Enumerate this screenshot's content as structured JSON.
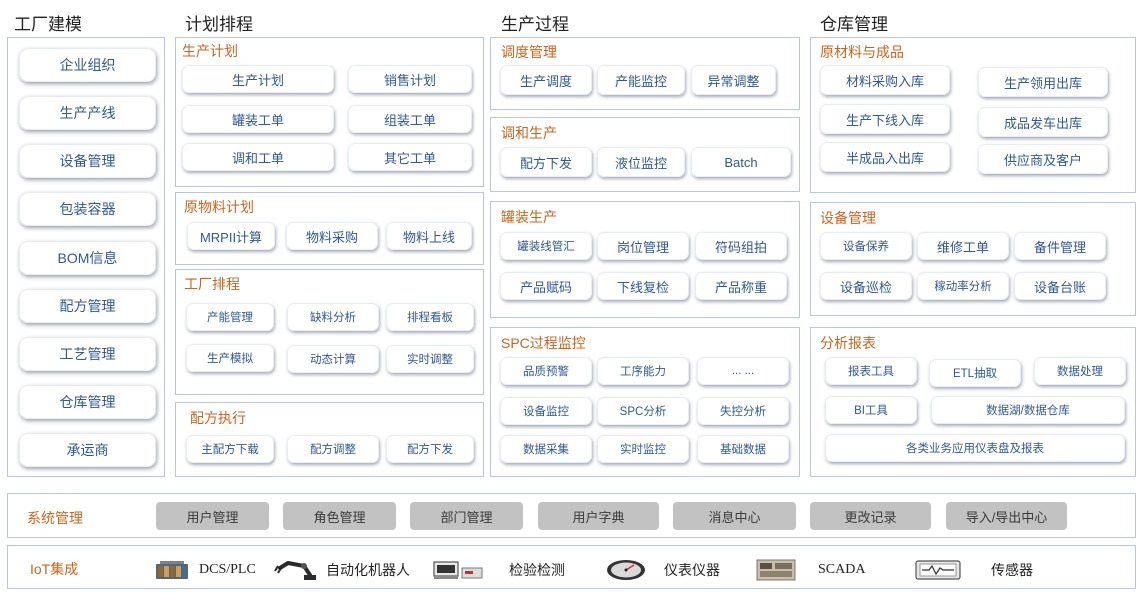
{
  "columns": {
    "factory": "工厂建模",
    "planning": "计划排程",
    "process": "生产过程",
    "warehouse": "仓库管理"
  },
  "factory_items": [
    "企业组织",
    "生产产线",
    "设备管理",
    "包装容器",
    "BOM信息",
    "配方管理",
    "工艺管理",
    "仓库管理",
    "承运商"
  ],
  "planning": {
    "production_plan": {
      "title": "生产计划",
      "items": [
        "生产计划",
        "销售计划",
        "罐装工单",
        "组装工单",
        "调和工单",
        "其它工单"
      ]
    },
    "material_plan": {
      "title": "原物料计划",
      "items": [
        "MRPII计算",
        "物料采购",
        "物料上线"
      ]
    },
    "scheduling": {
      "title": "工厂排程",
      "items": [
        "产能管理",
        "缺料分析",
        "排程看板",
        "生产模拟",
        "动态计算",
        "实时调整"
      ]
    },
    "recipe_exec": {
      "title": "配方执行",
      "items": [
        "主配方下载",
        "配方调整",
        "配方下发"
      ]
    }
  },
  "process": {
    "dispatch": {
      "title": "调度管理",
      "items": [
        "生产调度",
        "产能监控",
        "异常调整"
      ]
    },
    "blending": {
      "title": "调和生产",
      "items": [
        "配方下发",
        "液位监控",
        "Batch"
      ]
    },
    "filling": {
      "title": "罐装生产",
      "items": [
        "罐装线管汇",
        "岗位管理",
        "符码组拍",
        "产品赋码",
        "下线复检",
        "产品称重"
      ]
    },
    "spc": {
      "title": "SPC过程监控",
      "items": [
        "品质预警",
        "工序能力",
        "... ...",
        "设备监控",
        "SPC分析",
        "失控分析",
        "数据采集",
        "实时监控",
        "基础数据"
      ]
    }
  },
  "warehouse": {
    "materials": {
      "title": "原材料与成品",
      "items": [
        "材料采购入库",
        "生产领用出库",
        "生产下线入库",
        "成品发车出库",
        "半成品入出库",
        "供应商及客户"
      ]
    },
    "equipment": {
      "title": "设备管理",
      "items": [
        "设备保养",
        "维修工单",
        "备件管理",
        "设备巡检",
        "稼动率分析",
        "设备台账"
      ]
    },
    "reports": {
      "title": "分析报表",
      "items": [
        "报表工具",
        "ETL抽取",
        "数据处理",
        "BI工具",
        "数据湖/数据仓库",
        "各类业务应用仪表盘及报表"
      ]
    }
  },
  "system": {
    "label": "系统管理",
    "items": [
      "用户管理",
      "角色管理",
      "部门管理",
      "用户字典",
      "消息中心",
      "更改记录",
      "导入/导出中心"
    ]
  },
  "iot": {
    "label": "IoT集成",
    "items": [
      {
        "label": "DCS/PLC",
        "icon": "plc-rack-icon"
      },
      {
        "label": "自动化机器人",
        "icon": "robot-arm-icon"
      },
      {
        "label": "检验检测",
        "icon": "inspection-device-icon"
      },
      {
        "label": "仪表仪器",
        "icon": "gauge-icon"
      },
      {
        "label": "SCADA",
        "icon": "scada-panel-icon"
      },
      {
        "label": "传感器",
        "icon": "sensor-icon"
      }
    ]
  },
  "colors": {
    "frame_border": "#b9c6e0",
    "section_title": "#c8661e",
    "button_text": "#2f5a92",
    "gray_button": "#c2c2c2"
  }
}
